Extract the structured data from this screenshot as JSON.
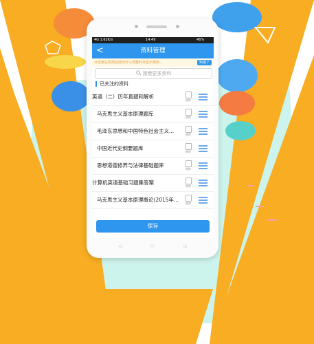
{
  "status_bar": {
    "left": "4G 1.62K/s",
    "time": "14:49",
    "battery": "46%"
  },
  "header": {
    "back_glyph": "<",
    "title": "资料管理"
  },
  "notice": {
    "text": "点击最右侧按钮拖动可以调整科目显示顺序。",
    "button_label": "知道了"
  },
  "search": {
    "placeholder": "搜索更多资料"
  },
  "section": {
    "title": "已关注的资料"
  },
  "list": {
    "delete_label": "移除",
    "items": [
      {
        "label": "英语（二）历年真题和解析",
        "indent": false
      },
      {
        "label": "马克思主义基本原理题库",
        "indent": true
      },
      {
        "label": "毛泽东思想和中国特色社会主义...",
        "indent": true
      },
      {
        "label": "中国近代史纲要题库",
        "indent": true
      },
      {
        "label": "思想道德修养与法律基础题库",
        "indent": true
      },
      {
        "label": "计算机英语基础习题集答案",
        "indent": false
      },
      {
        "label": "马克思主义基本原理概论(2015年...",
        "indent": true
      }
    ]
  },
  "footer": {
    "save_label": "保存"
  },
  "soft_keys": {
    "back": "◁",
    "home": "○",
    "recent": "◁"
  },
  "colors": {
    "accent": "#2e96ee",
    "background_orange": "#f8ad22",
    "background_mint": "#c8f2ea"
  }
}
